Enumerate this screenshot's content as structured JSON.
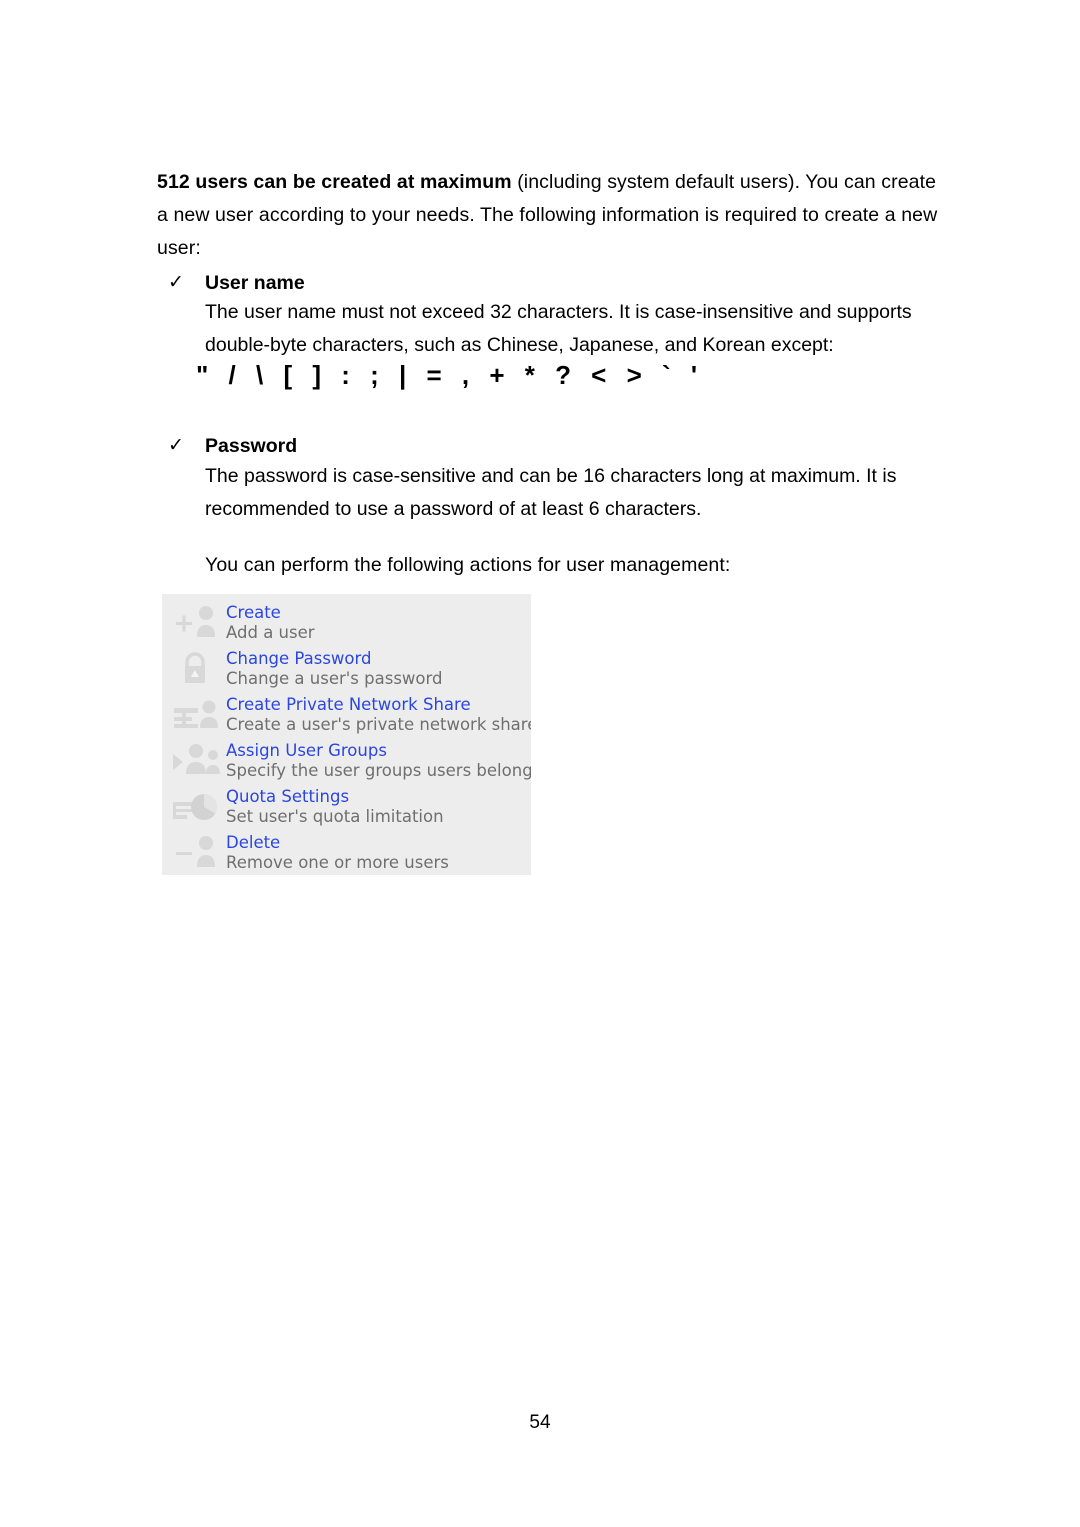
{
  "document": {
    "page_number": "54",
    "intro": {
      "bold_lead": "512 users can be created at maximum",
      "rest": " (including system default users).  You can create a new user according to your needs.  The following information is required to create a new user:"
    },
    "bullets": [
      {
        "marker": "✓",
        "label": "User name",
        "body": "The user name must not exceed 32 characters.  It is case-insensitive and supports double-byte characters, such as Chinese, Japanese, and Korean except:"
      },
      {
        "marker": "✓",
        "label": "Password",
        "body": "The password is case-sensitive and can be 16 characters long at maximum.  It is recommended to use a password of at least 6 characters."
      }
    ],
    "forbidden_characters": "\" / \\ [ ] : ; | = , + * ? < > ` '",
    "actions_intro": "You can perform the following actions for user management:"
  },
  "panel": {
    "background_color": "#ededed",
    "link_color": "#2b46e0",
    "description_color": "#6f6f6f",
    "actions": [
      {
        "icon": "add-user-icon",
        "title": "Create",
        "description": "Add a user"
      },
      {
        "icon": "padlock-icon",
        "title": "Change Password",
        "description": "Change a user's password"
      },
      {
        "icon": "network-share-user-icon",
        "title": "Create Private Network Share",
        "description": "Create a user's private network share"
      },
      {
        "icon": "assign-group-arrow-icon",
        "title": "Assign User Groups",
        "description": "Specify the user groups users belong to"
      },
      {
        "icon": "pie-chart-quota-icon",
        "title": "Quota Settings",
        "description": "Set user's quota limitation"
      },
      {
        "icon": "remove-user-icon",
        "title": "Delete",
        "description": "Remove one or more users"
      }
    ]
  }
}
